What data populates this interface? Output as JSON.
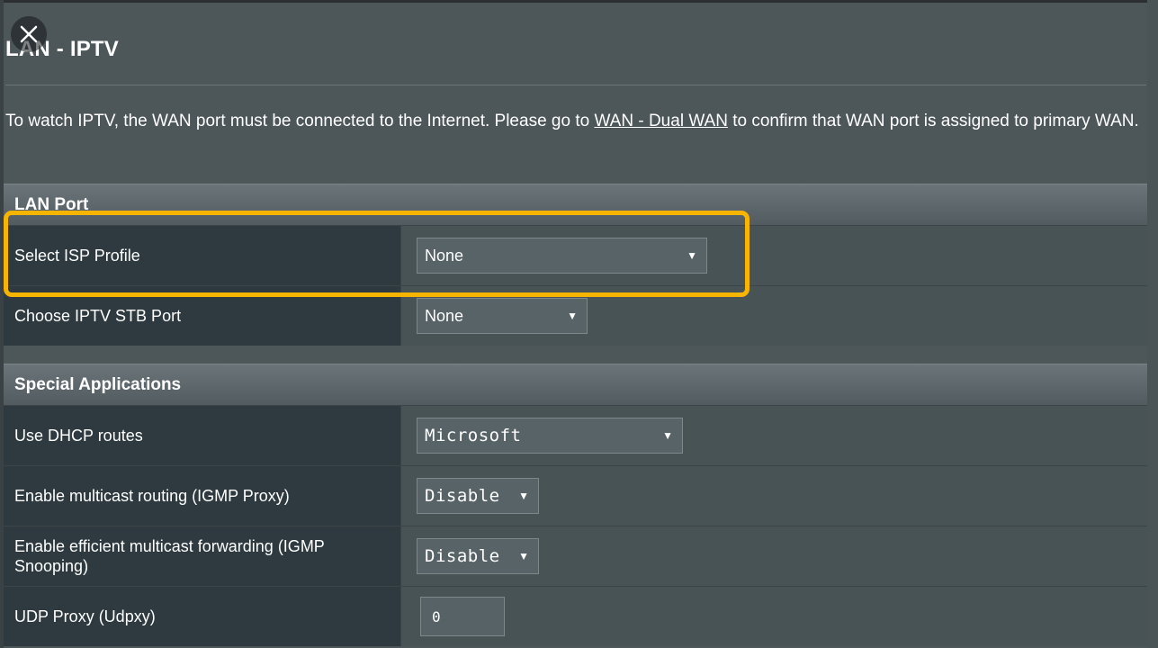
{
  "page": {
    "title": "LAN - IPTV",
    "description_before": "To watch IPTV, the WAN port must be connected to the Internet. Please go to ",
    "description_link": "WAN - Dual WAN",
    "description_after": " to confirm that WAN port is assigned to primary WAN."
  },
  "lan_port": {
    "header": "LAN Port",
    "rows": [
      {
        "label": "Select ISP Profile",
        "value": "None"
      },
      {
        "label": "Choose IPTV STB Port",
        "value": "None"
      }
    ]
  },
  "special_apps": {
    "header": "Special Applications",
    "rows": [
      {
        "label": "Use DHCP routes",
        "value": "Microsoft"
      },
      {
        "label": "Enable multicast routing (IGMP Proxy)",
        "value": "Disable"
      },
      {
        "label": "Enable efficient multicast forwarding (IGMP Snooping)",
        "value": "Disable"
      },
      {
        "label": "UDP Proxy (Udpxy)",
        "value": "0"
      }
    ]
  },
  "colors": {
    "highlight": "#f7b500",
    "background": "#4d5659",
    "label_cell": "#2e3a3f"
  },
  "icons": {
    "close": "close-icon",
    "dropdown": "caret-down-icon"
  }
}
